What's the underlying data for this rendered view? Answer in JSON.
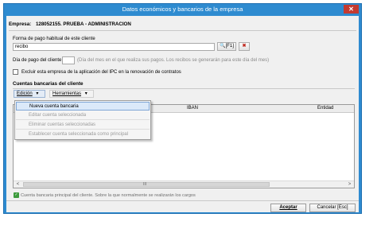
{
  "window": {
    "title": "Datos económicos y bancarios de la empresa",
    "close_glyph": "✕"
  },
  "empresa": {
    "label": "Empresa:",
    "value": "128052155. PRUEBA - ADMINISTRACION"
  },
  "forma_pago": {
    "label": "Forma de pago habitual de este cliente",
    "value": "recibo",
    "lookup_label": "[F1]"
  },
  "dia_pago": {
    "label": "Día de pago del cliente",
    "value": "",
    "hint": "(Día del mes en el que realiza sus pagos. Los recibos se generarán para este día del mes)"
  },
  "ipc": {
    "label": "Excluir esta empresa de la aplicación del IPC en la renovación de contratos",
    "checked": false
  },
  "cuentas": {
    "title": "Cuentas bancarias del cliente",
    "toolbar": {
      "edicion": "Edición",
      "herramientas": "Herramientas"
    },
    "columns": [
      "IBAN",
      "Entidad"
    ],
    "menu": [
      {
        "label": "Nueva cuenta bancaria",
        "enabled": true
      },
      {
        "label": "Editar cuenta seleccionada",
        "enabled": false
      },
      {
        "label": "Eliminar cuentas seleccionadas",
        "enabled": false
      },
      {
        "label": "Establecer cuenta seleccionada como principal",
        "enabled": false
      }
    ],
    "scroll_grip": "III",
    "note": "Cuenta bancaria principal del cliente. Sobre la que normalmente se realizarán los cargos"
  },
  "buttons": {
    "accept": "Aceptar",
    "cancel": "Cancelar [Esc]"
  },
  "colors": {
    "titlebar": "#2e8bd0",
    "close": "#c43a30",
    "menu_highlight": "#dbe9f9"
  }
}
